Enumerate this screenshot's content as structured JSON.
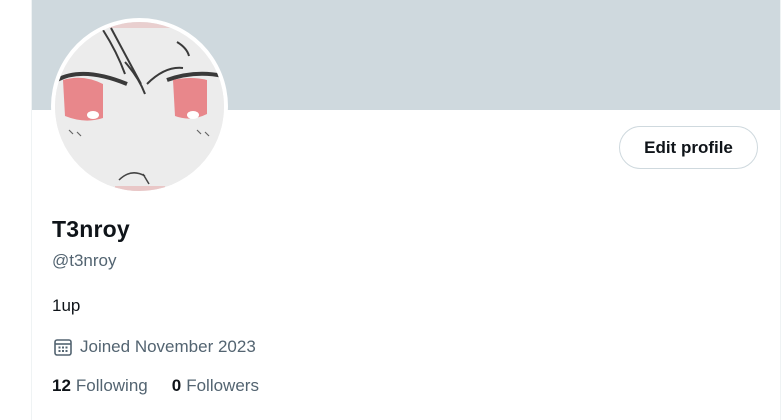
{
  "profile": {
    "display_name": "T3nroy",
    "handle": "@t3nroy",
    "bio": "1up",
    "joined": "Joined November 2023",
    "edit_label": "Edit profile",
    "following_count": "12",
    "following_label": "Following",
    "followers_count": "0",
    "followers_label": "Followers"
  },
  "icons": {
    "joined": "calendar-icon"
  },
  "colors": {
    "banner": "#cfd9de",
    "secondary_text": "#536471",
    "primary_text": "#0f1419",
    "avatar_eye": "#e8878b"
  }
}
